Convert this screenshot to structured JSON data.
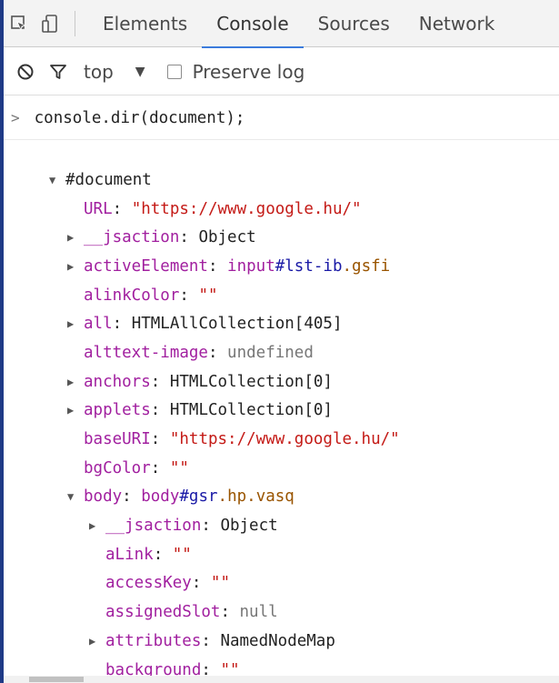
{
  "tabs": [
    {
      "label": "Elements",
      "active": false
    },
    {
      "label": "Console",
      "active": true
    },
    {
      "label": "Sources",
      "active": false
    },
    {
      "label": "Network",
      "active": false
    }
  ],
  "toolbar": {
    "inspect_icon": "cursor-select-icon",
    "device_icon": "device-toggle-icon"
  },
  "filter": {
    "clear_icon": "clear-console-icon",
    "filter_icon": "filter-icon",
    "context_label": "top",
    "preserve_log_label": "Preserve log"
  },
  "console": {
    "prompt": ">",
    "command": "console.dir(document);",
    "tree": {
      "root": "#document",
      "url_key": "URL",
      "url_val": "\"https://www.google.hu/\"",
      "jsaction_key": "__jsaction",
      "jsaction_val": "Object",
      "active_key": "activeElement",
      "active_tag": "input",
      "active_id": "#lst-ib",
      "active_cls": ".gsfi",
      "alink_key": "alinkColor",
      "alink_val": "\"\"",
      "all_key": "all",
      "all_val": "HTMLAllCollection[405]",
      "alttext_key": "alttext-image",
      "alttext_val": "undefined",
      "anchors_key": "anchors",
      "anchors_val": "HTMLCollection[0]",
      "applets_key": "applets",
      "applets_val": "HTMLCollection[0]",
      "baseuri_key": "baseURI",
      "baseuri_val": "\"https://www.google.hu/\"",
      "bgcolor_key": "bgColor",
      "bgcolor_val": "\"\"",
      "body_key": "body",
      "body_tag": "body",
      "body_id": "#gsr",
      "body_cls": ".hp.vasq",
      "b_jsaction_key": "__jsaction",
      "b_jsaction_val": "Object",
      "b_alink_key": "aLink",
      "b_alink_val": "\"\"",
      "b_accesskey_key": "accessKey",
      "b_accesskey_val": "\"\"",
      "b_slot_key": "assignedSlot",
      "b_slot_val": "null",
      "b_attr_key": "attributes",
      "b_attr_val": "NamedNodeMap",
      "b_bg_key": "background",
      "b_bg_val": "\"\""
    }
  },
  "colors": {
    "key": "#a11f9f",
    "string": "#c41a16",
    "active_tab_underline": "#3b7bdc",
    "background": "#1f3a86"
  }
}
